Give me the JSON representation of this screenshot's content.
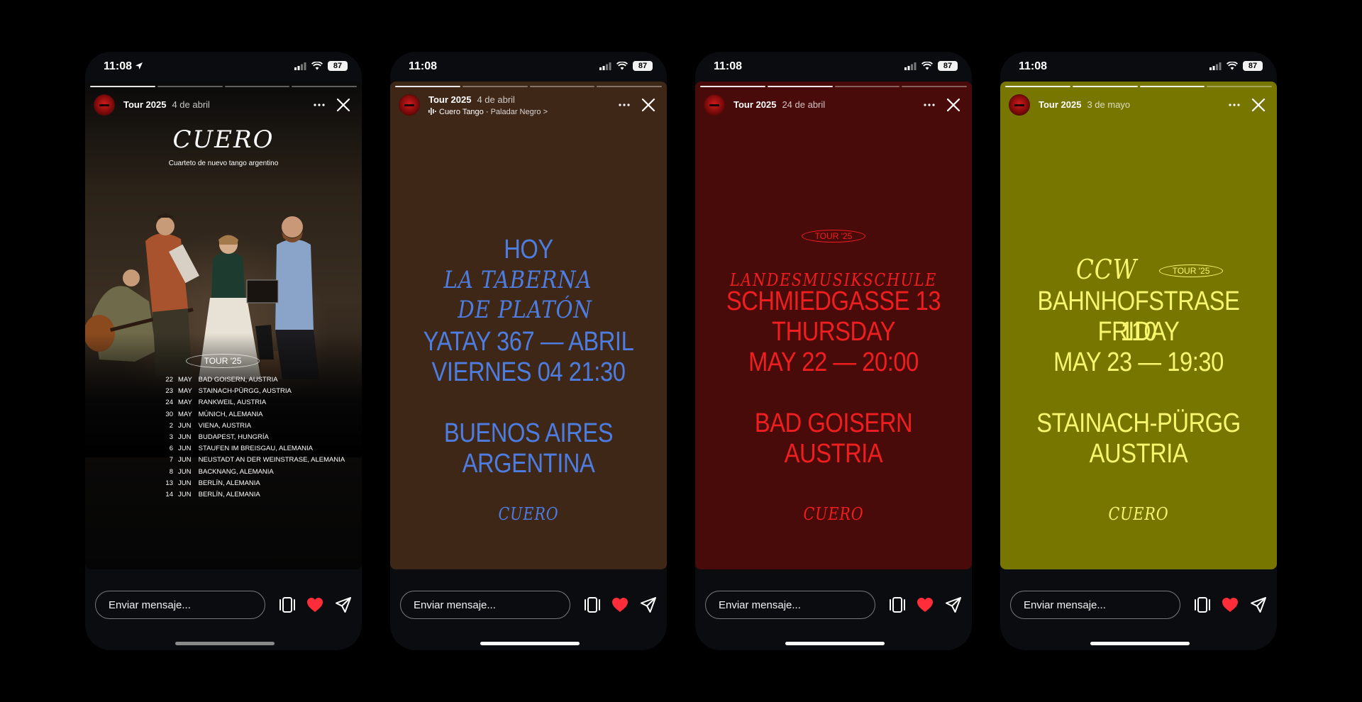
{
  "colors": {
    "story2_bg": "#3f2718",
    "story2_text": "#4d7de0",
    "story3_bg": "#490a0a",
    "story3_text": "#f01e1e",
    "story4_bg": "#777600",
    "story4_text": "#f8f66f",
    "heart": "#ff2d3a"
  },
  "common": {
    "time": "11:08",
    "battery": "87",
    "message_placeholder": "Enviar mensaje...",
    "username": "Tour 2025"
  },
  "stories": [
    {
      "date": "4 de abril",
      "poster_title": "CUERO",
      "poster_subtitle": "Cuarteto de nuevo tango argentino",
      "tour_label": "TOUR '25",
      "tour_dates": [
        {
          "day": "22",
          "month": "MAY",
          "place": "BAD GOISERN, AUSTRIA"
        },
        {
          "day": "23",
          "month": "MAY",
          "place": "STAINACH-PÜRGG, AUSTRIA"
        },
        {
          "day": "24",
          "month": "MAY",
          "place": "RANKWEIL, AUSTRIA"
        },
        {
          "day": "30",
          "month": "MAY",
          "place": "MÚNICH, ALEMANIA"
        },
        {
          "day": "2",
          "month": "JUN",
          "place": "VIENA, AUSTRIA"
        },
        {
          "day": "3",
          "month": "JUN",
          "place": "BUDAPEST, HUNGRÍA"
        },
        {
          "day": "6",
          "month": "JUN",
          "place": "STAUFEN IM BREISGAU, ALEMANIA"
        },
        {
          "day": "7",
          "month": "JUN",
          "place": "NEUSTADT AN DER WEINSTRASE, ALEMANIA"
        },
        {
          "day": "8",
          "month": "JUN",
          "place": "BACKNANG, ALEMANIA"
        },
        {
          "day": "13",
          "month": "JUN",
          "place": "BERLÍN, ALEMANIA"
        },
        {
          "day": "14",
          "month": "JUN",
          "place": "BERLÍN, ALEMANIA"
        }
      ]
    },
    {
      "date": "4 de abril",
      "music_title": "Cuero Tango",
      "music_subtitle": "Paladar Negro >",
      "line1": "HOY",
      "venue_line1": "LA TABERNA",
      "venue_line2": "DE PLATÓN",
      "line_address": "YATAY 367 — ABRIL",
      "line_date": "VIERNES 04 21:30",
      "city": "BUENOS AIRES",
      "country": "ARGENTINA",
      "signature": "CUERO"
    },
    {
      "date": "24 de abril",
      "tour_label": "TOUR '25",
      "venue": "LANDESMUSIKSCHULE",
      "line_address": "SCHMIEDGASSE 13",
      "line_day": "THURSDAY",
      "line_date": "MAY 22 — 20:00",
      "city": "BAD GOISERN",
      "country": "AUSTRIA",
      "signature": "CUERO"
    },
    {
      "date": "3 de mayo",
      "venue": "CCW",
      "tour_label": "TOUR '25",
      "line_address": "BAHNHOFSTRASE 110",
      "line_day": "FRIDAY",
      "line_date": "MAY 23 — 19:30",
      "city": "STAINACH-PÜRGG",
      "country": "AUSTRIA",
      "signature": "CUERO"
    }
  ]
}
